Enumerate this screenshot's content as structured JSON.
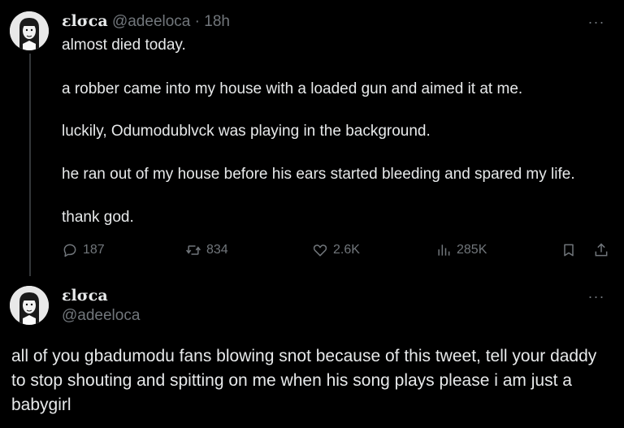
{
  "tweet1": {
    "author_name": "ɛlσca",
    "author_handle": "@adeeloca",
    "separator": "·",
    "time": "18h",
    "more": "···",
    "lines": [
      "almost died today.",
      "a robber came into my house with a loaded gun and aimed it at me.",
      "luckily, Odumodublvck was playing in the background.",
      "he ran out of my house before his ears started bleeding and spared my life.",
      "thank god."
    ],
    "stats": {
      "replies": "187",
      "reposts": "834",
      "likes": "2.6K",
      "views": "285K"
    },
    "icons": [
      "reply-icon",
      "repost-icon",
      "like-icon",
      "views-icon",
      "bookmark-icon",
      "share-icon"
    ]
  },
  "tweet2": {
    "author_name": "ɛlσca",
    "author_handle": "@adeeloca",
    "more": "···",
    "text": "all of you gbadumodu fans blowing snot because of this tweet, tell your daddy to stop shouting and spitting on me when his song plays please i am just a babygirl"
  },
  "colors": {
    "background": "#000000",
    "text": "#e7e9ea",
    "secondary": "#71767b",
    "thread_line": "#333639"
  }
}
